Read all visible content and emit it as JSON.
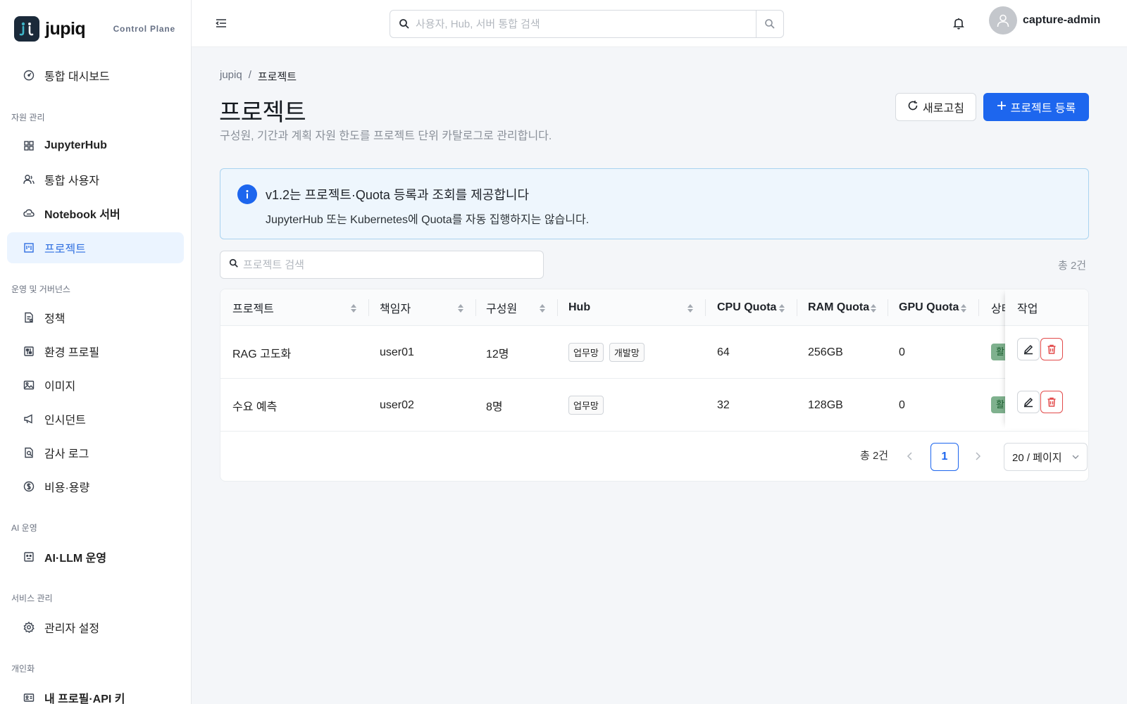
{
  "brand": {
    "name": "jupiq",
    "subtitle": "Control Plane"
  },
  "sidebar": {
    "sections": [
      "자원 관리",
      "운영 및 거버넌스",
      "AI 운영",
      "서비스 관리",
      "개인화"
    ],
    "items": [
      {
        "label": "통합 대시보드",
        "icon": "dashboard-icon"
      },
      {
        "label": "JupyterHub",
        "icon": "grid-icon"
      },
      {
        "label": "통합 사용자",
        "icon": "users-icon"
      },
      {
        "label": "Notebook 서버",
        "icon": "cloud-icon"
      },
      {
        "label": "프로젝트",
        "icon": "kanban-icon",
        "active": true
      },
      {
        "label": "정책",
        "icon": "policy-icon"
      },
      {
        "label": "환경 프로필",
        "icon": "sliders-icon"
      },
      {
        "label": "이미지",
        "icon": "image-icon"
      },
      {
        "label": "인시던트",
        "icon": "megaphone-icon"
      },
      {
        "label": "감사 로그",
        "icon": "audit-icon"
      },
      {
        "label": "비용·용량",
        "icon": "dollar-icon"
      },
      {
        "label": "AI·LLM 운영",
        "icon": "robot-icon"
      },
      {
        "label": "관리자 설정",
        "icon": "gear-icon"
      },
      {
        "label": "내 프로필·API 키",
        "icon": "id-card-icon"
      }
    ]
  },
  "header": {
    "search_placeholder": "사용자, Hub, 서버 통합 검색",
    "user": "capture-admin"
  },
  "breadcrumb": {
    "root": "jupiq",
    "sep": "/",
    "current": "프로젝트"
  },
  "page": {
    "title": "프로젝트",
    "description": "구성원, 기간과 계획 자원 한도를 프로젝트 단위 카탈로그로 관리합니다.",
    "refresh_label": "새로고침",
    "register_label": "프로젝트 등록"
  },
  "info": {
    "title": "v1.2는 프로젝트·Quota 등록과 조회를 제공합니다",
    "body": "JupyterHub 또는 Kubernetes에 Quota를 자동 집행하지는 않습니다."
  },
  "filter": {
    "placeholder": "프로젝트 검색",
    "total": "총 2건"
  },
  "table": {
    "columns": [
      "프로젝트",
      "책임자",
      "구성원",
      "Hub",
      "CPU Quota",
      "RAM Quota",
      "GPU Quota",
      "상태",
      "작업"
    ],
    "rows": [
      {
        "project": "RAG 고도화",
        "owner": "user01",
        "members": "12명",
        "hubs": [
          "업무망",
          "개발망"
        ],
        "cpu": "64",
        "ram": "256GB",
        "gpu": "0",
        "status": "활성"
      },
      {
        "project": "수요 예측",
        "owner": "user02",
        "members": "8명",
        "hubs": [
          "업무망"
        ],
        "cpu": "32",
        "ram": "128GB",
        "gpu": "0",
        "status": "활성"
      }
    ]
  },
  "pagination": {
    "total": "총 2건",
    "page": "1",
    "page_size": "20 / 페이지"
  },
  "colors": {
    "primary": "#1d66ee",
    "active_bg": "#ebf4ff",
    "danger": "#e24b4b",
    "info_bg": "#eef6fd"
  }
}
